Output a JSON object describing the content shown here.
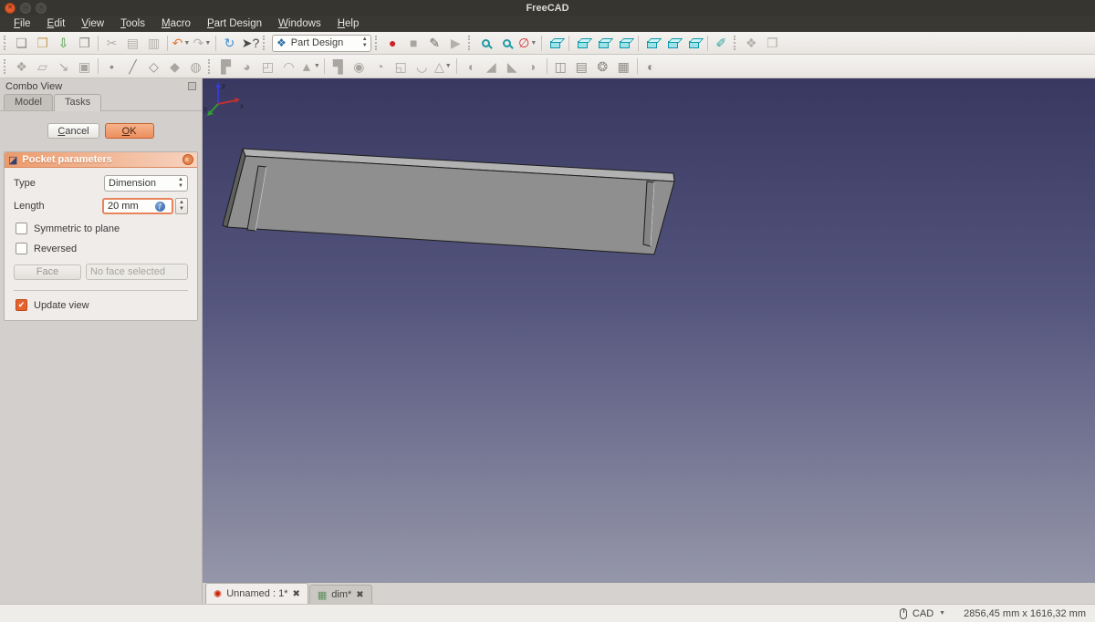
{
  "window": {
    "title": "FreeCAD",
    "controls": [
      "close",
      "minimize",
      "maximize"
    ]
  },
  "menu": {
    "items": [
      {
        "label": "File"
      },
      {
        "label": "Edit"
      },
      {
        "label": "View"
      },
      {
        "label": "Tools"
      },
      {
        "label": "Macro"
      },
      {
        "label": "Part Design"
      },
      {
        "label": "Windows"
      },
      {
        "label": "Help"
      }
    ]
  },
  "toolbar1": {
    "items": [
      {
        "handle": true
      },
      {
        "name": "new-document",
        "glyph": "❏",
        "color": "#8f8b87"
      },
      {
        "name": "open-document",
        "glyph": "❐",
        "color": "#c8a35f"
      },
      {
        "name": "save-document",
        "glyph": "⇩",
        "color": "#3f9b3f"
      },
      {
        "name": "print-document",
        "glyph": "❒",
        "color": "#8f8b87"
      },
      {
        "sep": true
      },
      {
        "name": "cut",
        "glyph": "✂",
        "color": "#b3afab",
        "disabled": true
      },
      {
        "name": "copy",
        "glyph": "▤",
        "color": "#b3afab",
        "disabled": true
      },
      {
        "name": "paste",
        "glyph": "▥",
        "color": "#b3afab",
        "disabled": true
      },
      {
        "sep": true
      },
      {
        "name": "undo",
        "glyph": "↶",
        "color": "#e07b39",
        "arrow": true
      },
      {
        "name": "redo",
        "glyph": "↷",
        "color": "#b3afab",
        "disabled": true,
        "arrow": true
      },
      {
        "sep": true
      },
      {
        "name": "refresh",
        "glyph": "↻",
        "color": "#3f8fd2"
      },
      {
        "name": "whats-this",
        "glyph": "➤?",
        "color": "#4a4a4a"
      },
      {
        "handle": true
      },
      {
        "combo": true,
        "name": "workbench-selector",
        "glyph": "❖",
        "color": "#2d6ca2",
        "label": "Part Design"
      },
      {
        "handle": true
      },
      {
        "name": "macro-record",
        "glyph": "●",
        "color": "#cc2222"
      },
      {
        "name": "macro-stop",
        "glyph": "■",
        "color": "#a8a4a0"
      },
      {
        "name": "macro-edit",
        "glyph": "✎",
        "color": "#6a6660"
      },
      {
        "name": "macro-play",
        "glyph": "▶",
        "color": "#b3afab",
        "disabled": true
      },
      {
        "handle": true
      },
      {
        "css": "mag",
        "name": "fit-all"
      },
      {
        "css": "mag",
        "name": "zoom-tool"
      },
      {
        "name": "draw-style",
        "glyph": "∅",
        "color": "#cc3333",
        "arrow": true
      },
      {
        "sep": true
      },
      {
        "css": "cube",
        "name": "view-axonometric"
      },
      {
        "sep": true
      },
      {
        "css": "cube",
        "name": "view-front"
      },
      {
        "css": "cube",
        "name": "view-top"
      },
      {
        "css": "cube",
        "name": "view-right"
      },
      {
        "sep": true
      },
      {
        "css": "cube",
        "name": "view-rear"
      },
      {
        "css": "cube",
        "name": "view-bottom"
      },
      {
        "css": "cube",
        "name": "view-left"
      },
      {
        "sep": true
      },
      {
        "name": "measure",
        "glyph": "✐",
        "color": "#2aa6a0"
      },
      {
        "handle": true
      },
      {
        "name": "clipboard-tool",
        "glyph": "❖",
        "color": "#b3afab",
        "disabled": true
      },
      {
        "name": "folder-tool",
        "glyph": "❐",
        "color": "#b3afab",
        "disabled": true
      }
    ]
  },
  "toolbar2": {
    "items": [
      {
        "handle": true
      },
      {
        "name": "create-body",
        "glyph": "❖",
        "color": "#a9a5a1",
        "disabled": true
      },
      {
        "name": "create-sketch",
        "glyph": "▱",
        "color": "#a9a5a1",
        "disabled": true
      },
      {
        "name": "map-sketch",
        "glyph": "↘",
        "color": "#a9a5a1",
        "disabled": true
      },
      {
        "name": "edit-sketch",
        "glyph": "▣",
        "color": "#a9a5a1",
        "disabled": true
      },
      {
        "sep": true
      },
      {
        "name": "datum-point",
        "glyph": "•",
        "color": "#8f8b87",
        "disabled": true
      },
      {
        "name": "datum-line",
        "glyph": "╱",
        "color": "#8f8b87",
        "disabled": true
      },
      {
        "name": "datum-plane",
        "glyph": "◇",
        "color": "#8f8b87",
        "disabled": true
      },
      {
        "name": "shape-binder",
        "glyph": "◆",
        "color": "#a9a5a1",
        "disabled": true
      },
      {
        "name": "clone",
        "glyph": "◍",
        "color": "#a9a5a1",
        "disabled": true
      },
      {
        "handle": true
      },
      {
        "name": "pad",
        "glyph": "▛",
        "color": "#a9a5a1",
        "disabled": true
      },
      {
        "name": "revolution",
        "glyph": "◕",
        "color": "#a9a5a1",
        "disabled": true
      },
      {
        "name": "additive-loft",
        "glyph": "◰",
        "color": "#a9a5a1",
        "disabled": true
      },
      {
        "name": "additive-pipe",
        "glyph": "◠",
        "color": "#a9a5a1",
        "disabled": true
      },
      {
        "name": "additive-primitive",
        "glyph": "▲",
        "color": "#a9a5a1",
        "disabled": true,
        "arrow": true
      },
      {
        "sep": true
      },
      {
        "name": "pocket",
        "glyph": "▜",
        "color": "#a9a5a1",
        "disabled": true
      },
      {
        "name": "hole",
        "glyph": "◉",
        "color": "#a9a5a1",
        "disabled": true
      },
      {
        "name": "groove",
        "glyph": "◔",
        "color": "#a9a5a1",
        "disabled": true
      },
      {
        "name": "subtractive-loft",
        "glyph": "◱",
        "color": "#a9a5a1",
        "disabled": true
      },
      {
        "name": "subtractive-pipe",
        "glyph": "◡",
        "color": "#a9a5a1",
        "disabled": true
      },
      {
        "name": "subtractive-primitive",
        "glyph": "△",
        "color": "#a9a5a1",
        "disabled": true,
        "arrow": true
      },
      {
        "sep": true
      },
      {
        "name": "fillet",
        "glyph": "◖",
        "color": "#a9a5a1",
        "disabled": true
      },
      {
        "name": "chamfer",
        "glyph": "◢",
        "color": "#a9a5a1",
        "disabled": true
      },
      {
        "name": "draft",
        "glyph": "◣",
        "color": "#a9a5a1",
        "disabled": true
      },
      {
        "name": "thickness",
        "glyph": "◗",
        "color": "#a9a5a1",
        "disabled": true
      },
      {
        "sep": true
      },
      {
        "name": "mirrored",
        "glyph": "◫",
        "color": "#8f8b87",
        "disabled": true
      },
      {
        "name": "linear-pattern",
        "glyph": "▤",
        "color": "#8f8b87",
        "disabled": true
      },
      {
        "name": "polar-pattern",
        "glyph": "❂",
        "color": "#8f8b87",
        "disabled": true
      },
      {
        "name": "multitransform",
        "glyph": "▦",
        "color": "#8f8b87",
        "disabled": true
      },
      {
        "sep": true
      },
      {
        "name": "boolean-operation",
        "glyph": "◐",
        "color": "#8f8b87",
        "disabled": true
      }
    ]
  },
  "combo_view": {
    "title": "Combo View",
    "tabs": [
      {
        "label": "Model",
        "active": false
      },
      {
        "label": "Tasks",
        "active": true
      }
    ],
    "cancel_label": "Cancel",
    "ok_label": "OK",
    "task": {
      "title": "Pocket parameters",
      "type_label": "Type",
      "type_value": "Dimension",
      "length_label": "Length",
      "length_value": "20 mm",
      "symmetric": {
        "label": "Symmetric to plane",
        "checked": false
      },
      "reversed": {
        "label": "Reversed",
        "checked": false
      },
      "face_button": "Face",
      "face_placeholder": "No face selected",
      "update_view": {
        "label": "Update view",
        "checked": true
      }
    }
  },
  "viewport": {
    "background_top": "#383861",
    "background_bottom": "#9596a9",
    "object": "gray rectangular plate with two rectangular slot pockets, shown in perspective",
    "axis_labels": [
      "z",
      "x",
      "y"
    ],
    "axis_colors": {
      "x": "#c03030",
      "y": "#2f9e2f",
      "z": "#3a3ace"
    }
  },
  "mdi_tabs": [
    {
      "label": "Unnamed : 1*",
      "active": true,
      "icon": "freecad-document"
    },
    {
      "label": "dim*",
      "active": false,
      "icon": "spreadsheet"
    }
  ],
  "statusbar": {
    "nav_style": "CAD",
    "dimensions": "2856,45 mm x 1616,32 mm"
  }
}
